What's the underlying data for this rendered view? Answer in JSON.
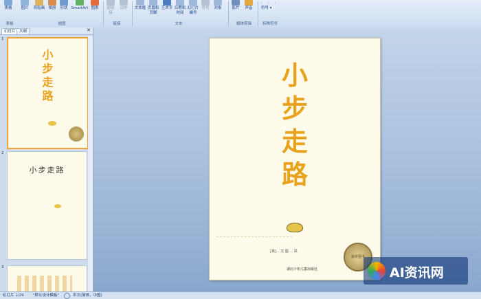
{
  "ribbon": {
    "buttons": [
      "表格",
      "图片",
      "剪贴画",
      "相册",
      "形状",
      "SmartArt",
      "图表",
      "超链接",
      "动作",
      "文本框",
      "页眉和页脚",
      "艺术字",
      "日期和时间",
      "幻灯片编号",
      "符号",
      "对象",
      "影片",
      "声音"
    ],
    "more_symbols": "符号",
    "groups": [
      "表格",
      "插图",
      "链接",
      "文本",
      "媒体剪辑",
      "特殊符号"
    ]
  },
  "panel": {
    "tabs": [
      "幻灯片",
      "大纲"
    ],
    "close": "✕",
    "slides": [
      {
        "number": "1",
        "title": "小步走路"
      },
      {
        "number": "2",
        "title": "小步走路"
      },
      {
        "number": "3"
      }
    ]
  },
  "slide": {
    "title_chars": [
      "小",
      "步",
      "走",
      "路"
    ],
    "credits": "[英]... 文 图     ... 译",
    "publisher": "湖北少年儿童出版社",
    "seal": "获奖图书"
  },
  "status": {
    "slide_pos": "幻灯片 1/29",
    "theme": "\"默认设计模板\"",
    "language": "中文(简体，中国)"
  },
  "watermark": "AI资讯网"
}
